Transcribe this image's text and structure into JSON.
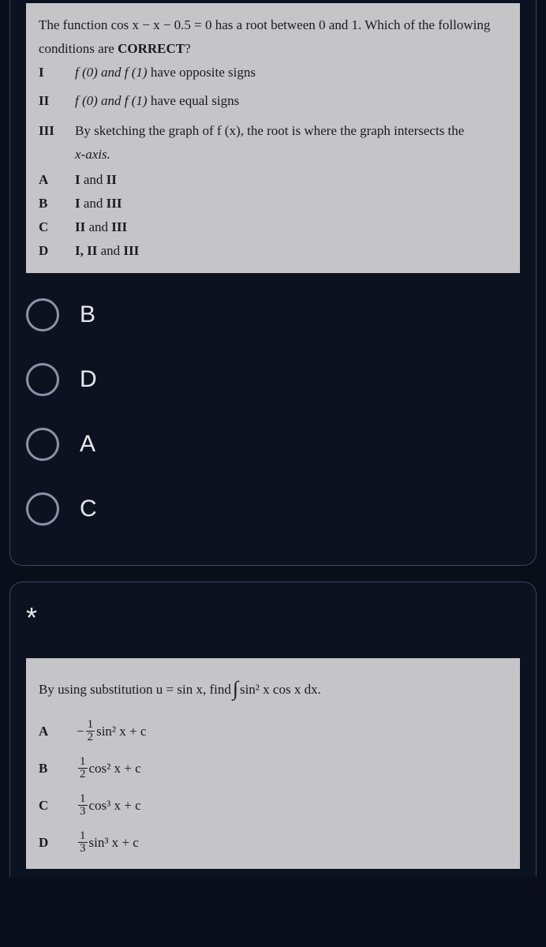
{
  "q1": {
    "stem_1": "The function  cos x − x − 0.5 = 0  has a root between 0 and 1. Which of the following",
    "stem_2a": "conditions are ",
    "stem_2b": "CORRECT",
    "stem_2c": "?",
    "conditions": [
      {
        "lbl": "I",
        "pre": "f (0) and  f (1)",
        "post": " have opposite signs"
      },
      {
        "lbl": "II",
        "pre": "f (0) and  f (1)",
        "post": " have equal signs"
      },
      {
        "lbl": "III",
        "pre": "",
        "post": "By sketching the graph of  f (x),  the root is where the graph intersects the"
      }
    ],
    "cond3_cont": "x-axis.",
    "choices": [
      {
        "lbl": "A",
        "txt_1": "I",
        "txt_2": " and ",
        "txt_3": "II"
      },
      {
        "lbl": "B",
        "txt_1": "I",
        "txt_2": " and ",
        "txt_3": "III"
      },
      {
        "lbl": "C",
        "txt_1": "II",
        "txt_2": " and ",
        "txt_3": "III"
      },
      {
        "lbl": "D",
        "txt_1": "I, II",
        "txt_2": " and ",
        "txt_3": "III"
      }
    ],
    "options": [
      "B",
      "D",
      "A",
      "C"
    ]
  },
  "q2": {
    "required": "*",
    "stem_1": "By using substitution  u = sin x,  find  ",
    "stem_int": "∫",
    "stem_2": "sin² x  cos x  dx.",
    "choices": [
      {
        "lbl": "A",
        "neg": "−",
        "num": "1",
        "den": "2",
        "expr": "sin² x + c"
      },
      {
        "lbl": "B",
        "neg": "",
        "num": "1",
        "den": "2",
        "expr": "cos² x + c"
      },
      {
        "lbl": "C",
        "neg": "",
        "num": "1",
        "den": "3",
        "expr": "cos³ x + c"
      },
      {
        "lbl": "D",
        "neg": "",
        "num": "1",
        "den": "3",
        "expr": "sin³ x + c"
      }
    ]
  }
}
